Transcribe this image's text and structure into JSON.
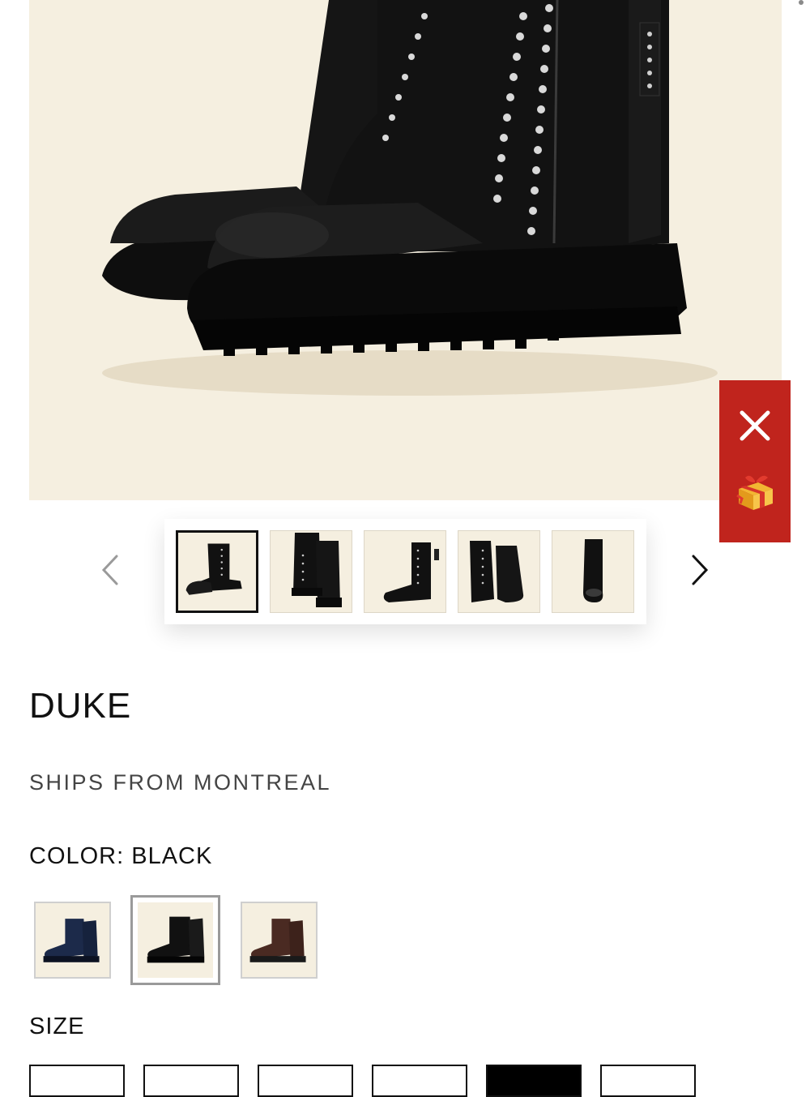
{
  "product": {
    "title": "DUKE",
    "shipping_note": "SHIPS FROM MONTREAL"
  },
  "gallery": {
    "main_image_alt": "Duke black studded leather ankle boot",
    "prev_icon": "chevron-left-icon",
    "next_icon": "chevron-right-icon",
    "thumbnails": [
      {
        "name": "thumb-1",
        "view": "side-pair",
        "active": true
      },
      {
        "name": "thumb-2",
        "view": "back-pair",
        "active": false
      },
      {
        "name": "thumb-3",
        "view": "side-single",
        "active": false
      },
      {
        "name": "thumb-4",
        "view": "front-pair",
        "active": false
      },
      {
        "name": "thumb-5",
        "view": "front-single",
        "active": false
      }
    ]
  },
  "promo": {
    "close_icon": "close-icon",
    "gift_icon": "gift-icon"
  },
  "color": {
    "label": "COLOR: BLACK",
    "options": [
      {
        "name": "navy",
        "hex": "#1c2a4a",
        "selected": false
      },
      {
        "name": "black",
        "hex": "#111111",
        "selected": true
      },
      {
        "name": "brown",
        "hex": "#4a2a22",
        "selected": false
      }
    ]
  },
  "size": {
    "label": "SIZE",
    "selected_index": 4,
    "options": [
      "",
      "",
      "",
      "",
      "",
      ""
    ]
  },
  "colors": {
    "background_cream": "#f5efe0",
    "promo_red": "#c0241d",
    "text_dark": "#111111",
    "text_muted": "#444444"
  }
}
